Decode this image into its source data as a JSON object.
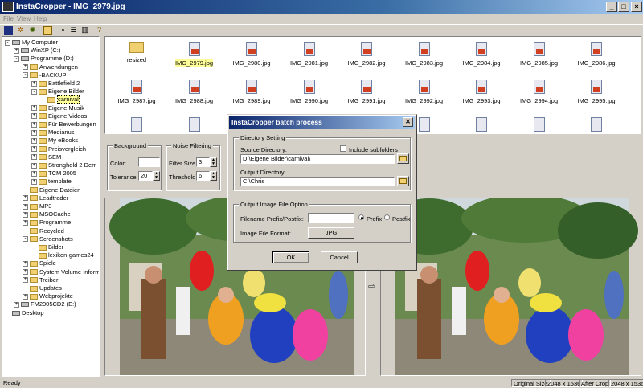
{
  "window": {
    "title": "InstaCropper - IMG_2979.jpg"
  },
  "menu": [
    "File",
    "View",
    "Help"
  ],
  "tree": [
    {
      "label": "My Computer",
      "depth": 0,
      "exp": "-",
      "kind": "computer"
    },
    {
      "label": "WinXP (C:)",
      "depth": 1,
      "exp": "+",
      "kind": "drive"
    },
    {
      "label": "Programme (D:)",
      "depth": 1,
      "exp": "-",
      "kind": "drive"
    },
    {
      "label": "Anwendungen",
      "depth": 2,
      "exp": "+",
      "kind": "folder"
    },
    {
      "label": "-BACKUP",
      "depth": 2,
      "exp": "-",
      "kind": "folder"
    },
    {
      "label": "Battlefield 2",
      "depth": 3,
      "exp": "+",
      "kind": "folder"
    },
    {
      "label": "Eigene Bilder",
      "depth": 3,
      "exp": "-",
      "kind": "folder"
    },
    {
      "label": "carnival",
      "depth": 4,
      "exp": "",
      "kind": "folder",
      "selected": true
    },
    {
      "label": "Eigene Musik",
      "depth": 3,
      "exp": "+",
      "kind": "folder"
    },
    {
      "label": "Eigene Videos",
      "depth": 3,
      "exp": "+",
      "kind": "folder"
    },
    {
      "label": "Für Bewerbungen",
      "depth": 3,
      "exp": "+",
      "kind": "folder"
    },
    {
      "label": "Medianus",
      "depth": 3,
      "exp": "+",
      "kind": "folder"
    },
    {
      "label": "My eBooks",
      "depth": 3,
      "exp": "+",
      "kind": "folder"
    },
    {
      "label": "Preisvergleich",
      "depth": 3,
      "exp": "+",
      "kind": "folder"
    },
    {
      "label": "SEM",
      "depth": 3,
      "exp": "+",
      "kind": "folder"
    },
    {
      "label": "Stronghold 2 Dem",
      "depth": 3,
      "exp": "+",
      "kind": "folder"
    },
    {
      "label": "TCM 2005",
      "depth": 3,
      "exp": "+",
      "kind": "folder"
    },
    {
      "label": "template",
      "depth": 3,
      "exp": "+",
      "kind": "folder"
    },
    {
      "label": "Eigene Dateien",
      "depth": 2,
      "exp": "",
      "kind": "folder"
    },
    {
      "label": "Leadtrader",
      "depth": 2,
      "exp": "+",
      "kind": "folder"
    },
    {
      "label": "MP3",
      "depth": 2,
      "exp": "+",
      "kind": "folder"
    },
    {
      "label": "MSOCache",
      "depth": 2,
      "exp": "+",
      "kind": "folder"
    },
    {
      "label": "Programme",
      "depth": 2,
      "exp": "+",
      "kind": "folder"
    },
    {
      "label": "Recycled",
      "depth": 2,
      "exp": "",
      "kind": "folder"
    },
    {
      "label": "Screenshots",
      "depth": 2,
      "exp": "-",
      "kind": "folder"
    },
    {
      "label": "Bilder",
      "depth": 3,
      "exp": "",
      "kind": "folder"
    },
    {
      "label": "lexikon-games24",
      "depth": 3,
      "exp": "",
      "kind": "folder"
    },
    {
      "label": "Spiele",
      "depth": 2,
      "exp": "+",
      "kind": "folder"
    },
    {
      "label": "System Volume Inform",
      "depth": 2,
      "exp": "+",
      "kind": "folder"
    },
    {
      "label": "Treiber",
      "depth": 2,
      "exp": "+",
      "kind": "folder"
    },
    {
      "label": "Updates",
      "depth": 2,
      "exp": "",
      "kind": "folder"
    },
    {
      "label": "Webprojekte",
      "depth": 2,
      "exp": "+",
      "kind": "folder"
    },
    {
      "label": "FM2005CD2 (E:)",
      "depth": 1,
      "exp": "+",
      "kind": "drive"
    },
    {
      "label": "Desktop",
      "depth": 0,
      "exp": "",
      "kind": "computer"
    }
  ],
  "files": [
    {
      "name": "resized",
      "type": "folder"
    },
    {
      "name": "IMG_2979.jpg",
      "type": "image",
      "selected": true
    },
    {
      "name": "IMG_2980.jpg",
      "type": "image"
    },
    {
      "name": "IMG_2981.jpg",
      "type": "image"
    },
    {
      "name": "IMG_2982.jpg",
      "type": "image"
    },
    {
      "name": "IMG_2983.jpg",
      "type": "image"
    },
    {
      "name": "IMG_2984.jpg",
      "type": "image"
    },
    {
      "name": "IMG_2985.jpg",
      "type": "image"
    },
    {
      "name": "IMG_2986.jpg",
      "type": "image"
    },
    {
      "name": "IMG_2987.jpg",
      "type": "image"
    },
    {
      "name": "IMG_2988.jpg",
      "type": "image"
    },
    {
      "name": "IMG_2989.jpg",
      "type": "image"
    },
    {
      "name": "IMG_2990.jpg",
      "type": "image"
    },
    {
      "name": "IMG_2991.jpg",
      "type": "image"
    },
    {
      "name": "IMG_2992.jpg",
      "type": "image"
    },
    {
      "name": "IMG_2993.jpg",
      "type": "image"
    },
    {
      "name": "IMG_2994.jpg",
      "type": "image"
    },
    {
      "name": "IMG_2995.jpg",
      "type": "image"
    }
  ],
  "background": {
    "title": "Background",
    "color_label": "Color:",
    "tolerance_label": "Tolerance:",
    "tolerance_value": "20"
  },
  "noise": {
    "title": "Noise Filtering",
    "filter_label": "Filter Size:",
    "filter_value": "3",
    "threshold_label": "Threshold:",
    "threshold_value": "6"
  },
  "dialog": {
    "title": "InstaCropper batch process",
    "close": "✕",
    "dir_group": "Directory Setting",
    "source_label": "Source Directory:",
    "include_sub": "Include subfolders",
    "source_value": "D:\\Eigene Bilder\\carnival\\",
    "output_label": "Output Directory:",
    "output_value": "C:\\Chris",
    "file_group": "Output Image File Option",
    "prefix_label": "Filename Prefix/Postfix:",
    "prefix_value": "",
    "prefix_opt": "Prefix",
    "postfix_opt": "Postfix",
    "format_label": "Image File Format:",
    "format_value": "JPG",
    "ok": "OK",
    "cancel": "Cancel"
  },
  "status": {
    "left": "Ready",
    "orig_label": "Original Size",
    "orig_value": "2048 x 1536",
    "after_label": "After Crop",
    "after_value": "2048 x 1536"
  }
}
